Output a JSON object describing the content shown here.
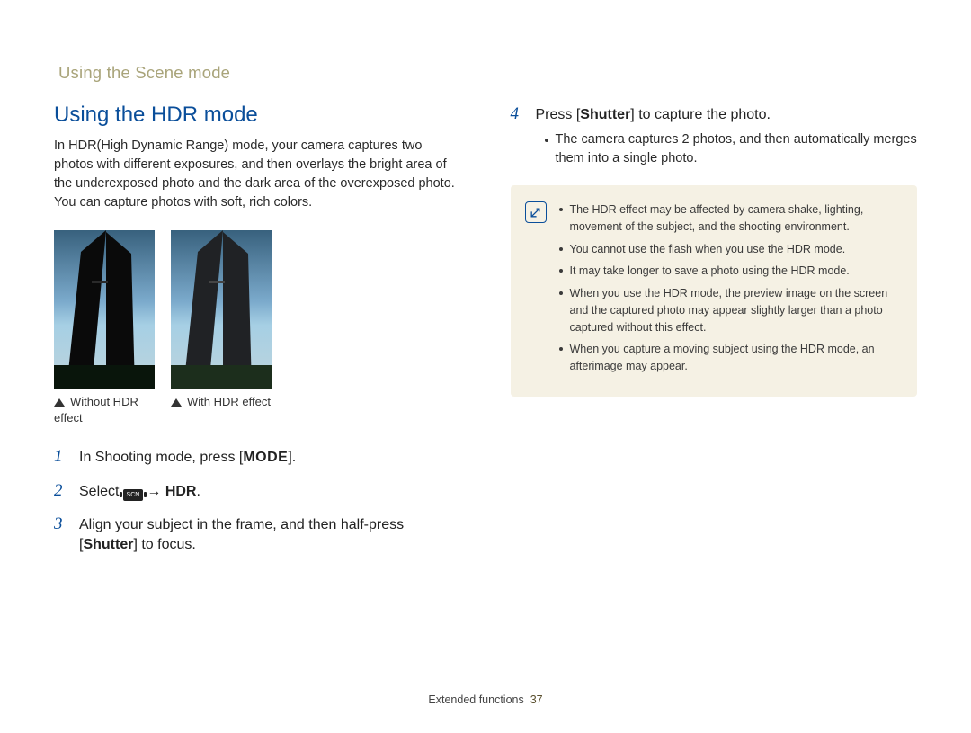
{
  "breadcrumb": "Using the Scene mode",
  "title": "Using the HDR mode",
  "intro": "In HDR(High Dynamic Range) mode, your camera captures two photos with different exposures, and then overlays the bright area of the underexposed photo and the dark area of the overexposed photo. You can capture photos with soft, rich colors.",
  "captions": {
    "without": "Without HDR effect",
    "with": "With HDR effect"
  },
  "steps": {
    "s1": {
      "num": "1",
      "pre": "In Shooting mode, press [",
      "btn": "MODE",
      "post": "]."
    },
    "s2": {
      "num": "2",
      "pre": "Select ",
      "scn": "SCN",
      "arrow": " → ",
      "hdr": "HDR",
      "post": "."
    },
    "s3": {
      "num": "3",
      "pre": "Align your subject in the frame, and then half-press [",
      "btn": "Shutter",
      "post": "] to focus."
    },
    "s4": {
      "num": "4",
      "pre": "Press [",
      "btn": "Shutter",
      "post": "] to capture the photo.",
      "bullet": "The camera captures 2 photos, and then automatically merges them into a single photo."
    }
  },
  "tips": {
    "t1": "The HDR effect may be affected by camera shake, lighting, movement of the subject, and the shooting environment.",
    "t2": "You cannot use the flash when you use the HDR mode.",
    "t3": "It may take longer to save a photo using the HDR mode.",
    "t4": "When you use the HDR mode, the preview image on the screen and the captured photo may appear slightly larger than a photo captured without this effect.",
    "t5": "When you capture a moving subject using the HDR mode, an afterimage may appear."
  },
  "footer": {
    "section": "Extended functions",
    "page": "37"
  },
  "icons": {
    "note": "note-icon",
    "arrowup": "arrow-up-icon",
    "scene": "scene-icon"
  }
}
